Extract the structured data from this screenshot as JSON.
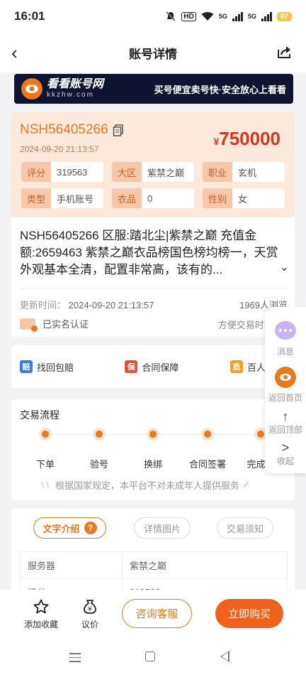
{
  "status_bar": {
    "time": "16:01",
    "hd": "HD",
    "net1": "5G",
    "net2": "5G",
    "battery": "67"
  },
  "header": {
    "title": "账号详情"
  },
  "banner": {
    "brand": "看看账号网",
    "domain": "kkzhw.com",
    "slogan": "买号便宜卖号快·安全放心上看看"
  },
  "account": {
    "id": "NSH56405266",
    "time": "2024-09-20 21:13:57",
    "price_symbol": "¥",
    "price": "750000",
    "attributes": [
      {
        "key": "评分",
        "value": "319563"
      },
      {
        "key": "大区",
        "value": "紫禁之巅"
      },
      {
        "key": "职业",
        "value": "玄机"
      },
      {
        "key": "类型",
        "value": "手机账号"
      },
      {
        "key": "衣品",
        "value": "0"
      },
      {
        "key": "性别",
        "value": "女"
      }
    ]
  },
  "description": {
    "text": "NSH56405266 区服:踏北尘|紫禁之巅 充值金额:2659463 紫禁之巅衣品榜国色榜均榜一，天赏外观基本全清，配置非常高，该有的...",
    "update_label": "更新时间：",
    "update_time": "2024-09-20 21:13:57",
    "views": "1969人浏览",
    "realname": "已实名认证",
    "convenient": "方便交易时间：0"
  },
  "guarantees": [
    {
      "icon": "赔",
      "label": "找回包赔",
      "color": "#3a7be0"
    },
    {
      "icon": "保",
      "label": "合同保障",
      "color": "#e2523a"
    },
    {
      "icon": "质",
      "label": "百人",
      "color": "#f0a02a"
    }
  ],
  "process": {
    "title": "交易流程",
    "steps": [
      "下单",
      "验号",
      "换绑",
      "合同签署",
      "完成交"
    ],
    "notice": "根据国家规定，本平台不对未成年人提供服务"
  },
  "tabs": [
    {
      "label": "文字介绍",
      "badge": "?"
    },
    {
      "label": "详情图片"
    },
    {
      "label": "交易须知"
    }
  ],
  "detail_table": [
    {
      "key": "服务器",
      "value": "紫禁之巅"
    },
    {
      "key": "评分",
      "value": "319563"
    }
  ],
  "float_menu": {
    "message": "消息",
    "home": "返回首页",
    "top": "返回顶部",
    "collapse": "收起"
  },
  "bottom_bar": {
    "favorite": "添加收藏",
    "bargain": "议价",
    "consult": "咨询客服",
    "buy": "立即购买"
  },
  "colors": {
    "accent": "#e8791f",
    "price": "#d4371f",
    "buy_button": "#f0621c"
  }
}
